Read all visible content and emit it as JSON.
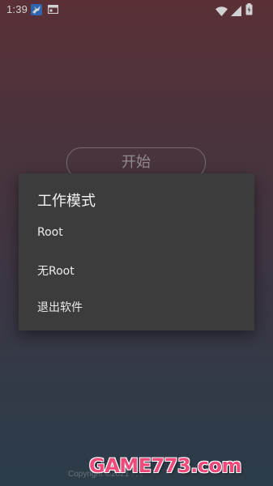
{
  "status_bar": {
    "time": "1:39",
    "app_icon": "bird-app-icon",
    "notification_icon": "window-icon",
    "wifi_icon": "wifi-icon",
    "signal_icon": "signal-icon",
    "battery_icon": "battery-icon"
  },
  "main": {
    "start_label": "开始",
    "copyright": "Copyright ©2021 . . ."
  },
  "dialog": {
    "title": "工作模式",
    "options": [
      {
        "label": "Root"
      },
      {
        "label": "无Root"
      },
      {
        "label": "退出软件"
      }
    ]
  },
  "watermark": {
    "text": "GAME773.com"
  },
  "colors": {
    "background_top": "#6e3b43",
    "background_bottom": "#364a5a",
    "dialog_bg": "#3c3c3c",
    "watermark": "#f04a7a"
  }
}
